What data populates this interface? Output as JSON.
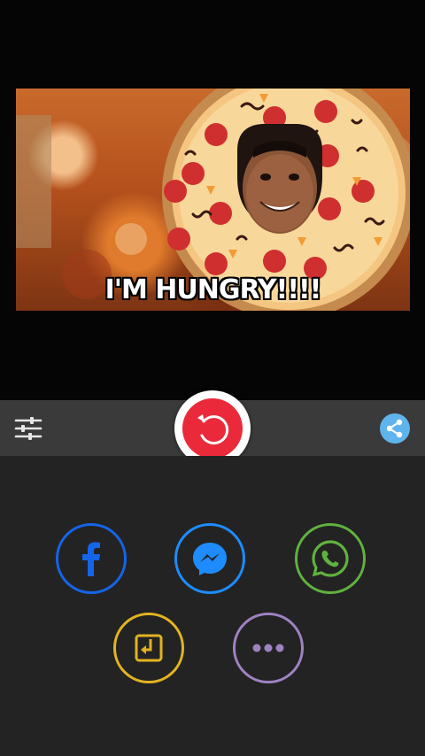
{
  "preview": {
    "caption": "I'M HUNGRY!!!!"
  },
  "toolbar": {
    "settings_icon": "sliders-icon",
    "replay_icon": "replay-icon",
    "share_icon": "share-icon"
  },
  "share_targets": [
    {
      "name": "facebook",
      "icon": "facebook-icon",
      "color": "#1565e8"
    },
    {
      "name": "messenger",
      "icon": "messenger-icon",
      "color": "#1e8cff"
    },
    {
      "name": "whatsapp",
      "icon": "whatsapp-icon",
      "color": "#5fb23f"
    },
    {
      "name": "save",
      "icon": "save-to-gallery-icon",
      "color": "#e3b320"
    },
    {
      "name": "more",
      "icon": "more-dots-icon",
      "color": "#9f82c2"
    }
  ],
  "colors": {
    "background": "#050505",
    "toolbar": "#3a3a3a",
    "panel": "#232323",
    "replay_accent": "#ea2a3a",
    "share_accent": "#5fb4ee"
  }
}
